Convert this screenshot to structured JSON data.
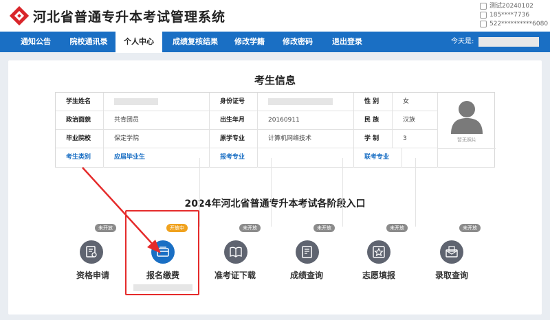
{
  "header": {
    "title": "河北省普通专升本考试管理系统",
    "user_lines": [
      "测试20240102",
      "185****7736",
      "522**********6080"
    ]
  },
  "nav": {
    "items": [
      {
        "label": "通知公告",
        "active": false
      },
      {
        "label": "院校通讯录",
        "active": false
      },
      {
        "label": "个人中心",
        "active": true
      },
      {
        "label": "成绩复核结果",
        "active": false
      },
      {
        "label": "修改学籍",
        "active": false
      },
      {
        "label": "修改密码",
        "active": false
      },
      {
        "label": "退出登录",
        "active": false
      }
    ],
    "greeting": "今天是:"
  },
  "student_info": {
    "title": "考生信息",
    "rows": [
      [
        {
          "label": "学生姓名",
          "value": ""
        },
        {
          "label": "身份证号",
          "value": ""
        },
        {
          "label": "性 别",
          "value": "女"
        }
      ],
      [
        {
          "label": "政治面貌",
          "value": "共青团员"
        },
        {
          "label": "出生年月",
          "value": "20160911"
        },
        {
          "label": "民 族",
          "value": "汉族"
        }
      ],
      [
        {
          "label": "毕业院校",
          "value": "保定学院"
        },
        {
          "label": "原学专业",
          "value": "计算机网络技术"
        },
        {
          "label": "学 制",
          "value": "3"
        }
      ],
      [
        {
          "label": "考生类别",
          "value": "应届毕业生"
        },
        {
          "label": "报考专业",
          "value": ""
        },
        {
          "label": "联考专业",
          "value": ""
        }
      ]
    ],
    "photo_caption": "暂无照片"
  },
  "stages": {
    "title": "2024年河北省普通专升本考试各阶段入口",
    "items": [
      {
        "label": "资格申请",
        "status": "未开放",
        "icon": "certificate-icon",
        "open": false
      },
      {
        "label": "报名缴费",
        "status": "开放中",
        "icon": "payment-card-icon",
        "open": true
      },
      {
        "label": "准考证下载",
        "status": "未开放",
        "icon": "book-icon",
        "open": false
      },
      {
        "label": "成绩查询",
        "status": "未开放",
        "icon": "score-sheet-icon",
        "open": false
      },
      {
        "label": "志愿填报",
        "status": "未开放",
        "icon": "star-form-icon",
        "open": false
      },
      {
        "label": "录取查询",
        "status": "未开放",
        "icon": "admission-mail-icon",
        "open": false
      }
    ]
  },
  "colors": {
    "primary": "#1a6fc4",
    "open_badge": "#f0a21e",
    "closed_badge": "#8b8b8b",
    "highlight": "#e52b2b"
  }
}
